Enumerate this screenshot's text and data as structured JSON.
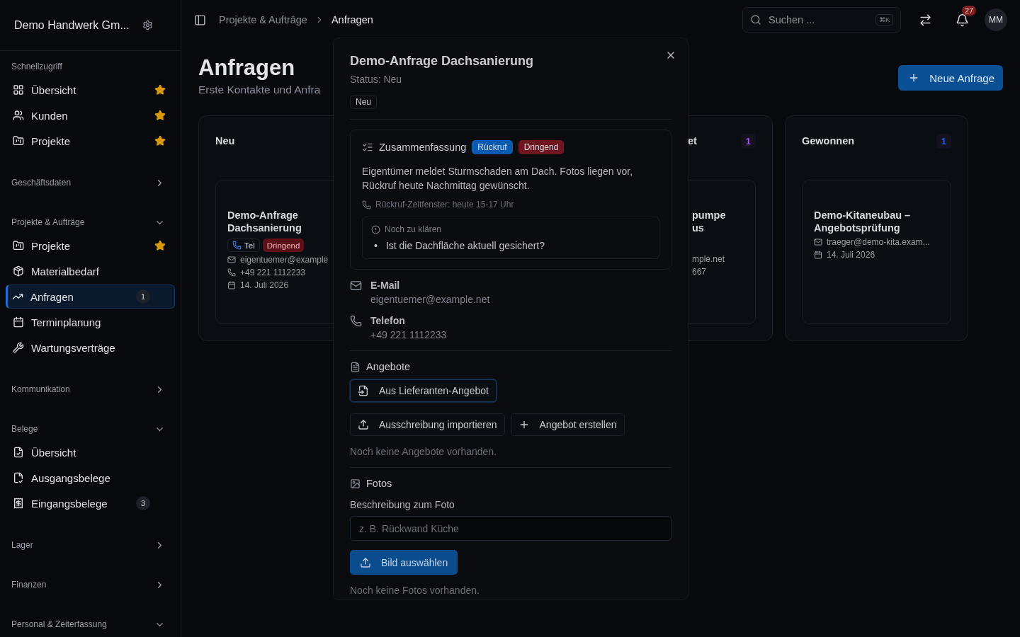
{
  "sidebar": {
    "company": "Demo Handwerk Gm...",
    "sections": [
      {
        "title": "Schnellzugriff",
        "items": [
          {
            "label": "Übersicht",
            "starred": true,
            "selected": false
          },
          {
            "label": "Kunden",
            "starred": true,
            "selected": false
          },
          {
            "label": "Projekte",
            "starred": true,
            "selected": false
          }
        ]
      },
      {
        "title": "Geschäftsdaten",
        "expanded": false
      },
      {
        "title": "Projekte & Aufträge",
        "expanded": true,
        "items": [
          {
            "label": "Projekte",
            "starred": true,
            "selected": false
          },
          {
            "label": "Materialbedarf",
            "starred": false,
            "selected": false
          },
          {
            "label": "Anfragen",
            "starred": false,
            "selected": true,
            "badge": "1"
          },
          {
            "label": "Terminplanung",
            "starred": false,
            "selected": false
          },
          {
            "label": "Wartungsverträge",
            "starred": false,
            "selected": false
          }
        ]
      },
      {
        "title": "Kommunikation",
        "expanded": false
      },
      {
        "title": "Belege",
        "expanded": true,
        "items": [
          {
            "label": "Übersicht",
            "starred": false,
            "selected": false
          },
          {
            "label": "Ausgangsbelege",
            "starred": false,
            "selected": false
          },
          {
            "label": "Eingangsbelege",
            "starred": false,
            "selected": false,
            "badge": "3"
          }
        ]
      },
      {
        "title": "Lager",
        "expanded": false
      },
      {
        "title": "Finanzen",
        "expanded": false
      },
      {
        "title": "Personal & Zeiterfassung",
        "expanded": true
      }
    ]
  },
  "topbar": {
    "breadcrumb": [
      "Projekte & Aufträge",
      "Anfragen"
    ],
    "search": {
      "placeholder": "Suchen ...",
      "shortcut": "⌘K"
    },
    "notifications": "27",
    "avatar": "MM"
  },
  "page": {
    "title": "Anfragen",
    "subtitle": "Erste Kontakte und Anfra",
    "new_button": "Neue Anfrage"
  },
  "board": [
    {
      "name": "Neu",
      "partly_covered": false,
      "cards": [
        {
          "title": "Demo-Anfrage Dachsanierung",
          "tags": [
            {
              "kind": "call",
              "label": "Tel"
            },
            {
              "kind": "priority",
              "label": "Dringend"
            }
          ],
          "details": [
            {
              "kind": "email",
              "text": "eigentuemer@example"
            },
            {
              "kind": "phone",
              "text": "+49 221 1112233"
            },
            {
              "kind": "date",
              "text": "14. Juli 2026"
            }
          ]
        }
      ]
    },
    {
      "name": "et",
      "count": "1",
      "color": "#a855f7",
      "partly_covered": true,
      "cards": [
        {
          "title": "pumpe us",
          "details": [
            {
              "kind": "email",
              "text": "mple.net"
            },
            {
              "kind": "phone",
              "text": "667"
            }
          ]
        }
      ]
    },
    {
      "name": "Gewonnen",
      "count": "1",
      "color": "#2563eb",
      "partly_covered": false,
      "cards": [
        {
          "title": "Demo-Kitaneubau – Angebotsprüfung",
          "details": [
            {
              "kind": "email",
              "text": "traeger@demo-kita.exam..."
            },
            {
              "kind": "date",
              "text": "14. Juli 2026"
            }
          ]
        }
      ]
    }
  ],
  "modal": {
    "title": "Demo-Anfrage Dachsanierung",
    "status": "Status: Neu",
    "status_badge": "Neu",
    "summary": {
      "heading": "Zusammenfassung",
      "tags": [
        {
          "label": "Rückruf",
          "color": "#0a5bb0"
        },
        {
          "label": "Dringend",
          "color": "#6e1520"
        }
      ],
      "text": "Eigentümer meldet Sturmschaden am Dach. Fotos liegen vor, Rückruf heute Nachmittag gewünscht.",
      "callback": "Rückruf-Zeitfenster: heute 15-17 Uhr",
      "open_questions": {
        "heading": "Noch zu klären",
        "bullet": "•",
        "items": [
          "Ist die Dachfläche aktuell gesichert?"
        ]
      }
    },
    "contacts": [
      {
        "kind": "email",
        "label": "E-Mail",
        "value": "eigentuemer@example.net"
      },
      {
        "kind": "phone",
        "label": "Telefon",
        "value": "+49 221 1112233"
      }
    ],
    "offers": {
      "heading": "Angebote",
      "buttons": [
        {
          "kind": "import",
          "label": "Aus Lieferanten-Angebot",
          "focused": true
        },
        {
          "kind": "upload",
          "label": "Ausschreibung importieren",
          "focused": false
        },
        {
          "kind": "create",
          "label": "Angebot erstellen",
          "focused": false
        }
      ],
      "empty": "Noch keine Angebote vorhanden."
    },
    "photos": {
      "heading": "Fotos",
      "field_label": "Beschreibung zum Foto",
      "placeholder": "z. B. Rückwand Küche",
      "button": "Bild auswählen",
      "empty": "Noch keine Fotos vorhanden."
    }
  }
}
